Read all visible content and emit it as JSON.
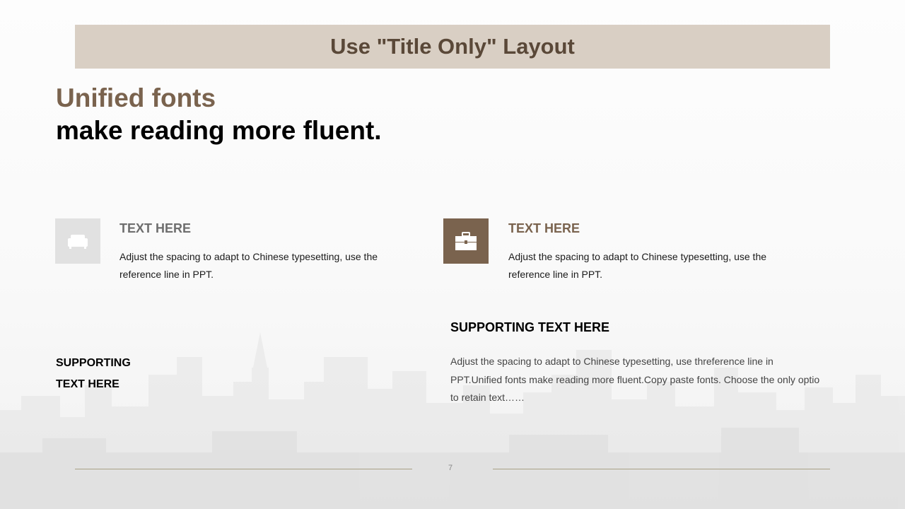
{
  "title": "Use \"Title Only\" Layout",
  "headline": {
    "line1": "Unified fonts",
    "line2": "make reading more fluent."
  },
  "cards": [
    {
      "icon": "sofa-icon",
      "title": "TEXT HERE",
      "body": "Adjust the spacing to adapt to Chinese typesetting, use the reference line in PPT."
    },
    {
      "icon": "briefcase-icon",
      "title": "TEXT HERE",
      "body": "Adjust the spacing to adapt to Chinese typesetting, use the reference line in PPT."
    }
  ],
  "supporting_left": {
    "line1": "SUPPORTING",
    "line2": "TEXT HERE"
  },
  "supporting_right": {
    "title": "SUPPORTING TEXT HERE",
    "body": "Adjust the spacing to adapt to Chinese typesetting, use threference line in PPT.Unified fonts make reading more fluent.Copy paste fonts. Choose the only optio to retain text……"
  },
  "page_number": "7",
  "colors": {
    "title_band": "#d9cfc4",
    "title_text": "#5a4838",
    "accent_brown": "#7a634e",
    "icon_gray": "#e1e1e1",
    "rule": "#a8a085"
  }
}
